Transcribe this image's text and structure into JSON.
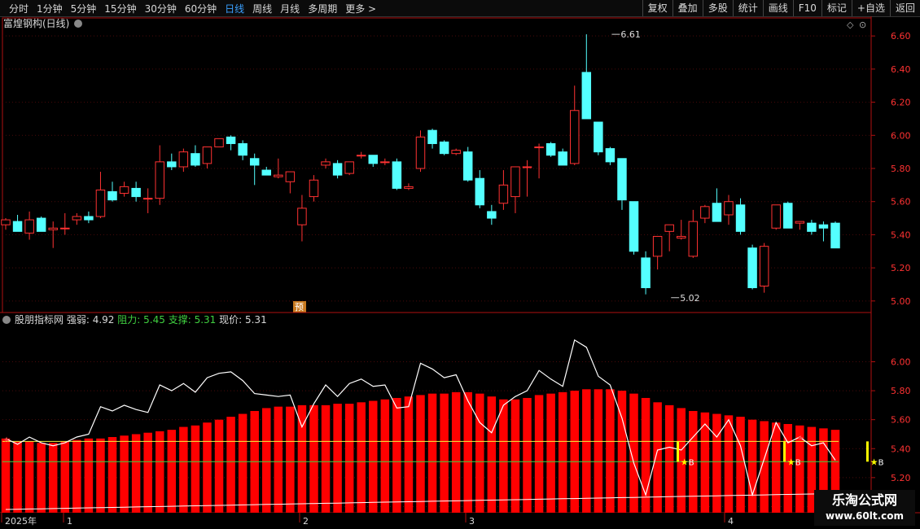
{
  "toolbar": {
    "periods": [
      "分时",
      "1分钟",
      "5分钟",
      "15分钟",
      "30分钟",
      "60分钟",
      "日线",
      "周线",
      "月线",
      "多周期",
      "更多 >"
    ],
    "active_period": "日线",
    "tools": [
      "复权",
      "叠加",
      "多股",
      "统计",
      "画线",
      "F10",
      "标记",
      "+自选",
      "返回"
    ]
  },
  "main_title": "富煌钢构(日线)",
  "pre_badge": "预",
  "indicator": {
    "name": "股朋指标网",
    "strength_label": "强弱:",
    "strength_value": "4.92",
    "resist_label": "阻力:",
    "resist_value": "5.45",
    "support_label": "支撑:",
    "support_value": "5.31",
    "price_label": "现价:",
    "price_value": "5.31"
  },
  "x_axis_labels": [
    "2025年",
    "1",
    "2",
    "3",
    "4"
  ],
  "watermark": {
    "line1": "乐淘公式网",
    "line2": "www.60lt.com"
  },
  "colors": {
    "up": "#ff3232",
    "down": "#54ffff",
    "bar_red": "#ff0000",
    "line_white": "#ffffff",
    "resist_line": "#f0f040",
    "support_line": "#40d040",
    "axis_red": "#b01010",
    "yellow": "#ffff00"
  },
  "chart_data": [
    {
      "type": "candlestick",
      "title": "富煌钢构(日线)",
      "ylim": [
        4.95,
        6.65
      ],
      "y_ticks": [
        5.0,
        5.2,
        5.4,
        5.6,
        5.8,
        6.0,
        6.2,
        6.4,
        6.6
      ],
      "annotations": [
        {
          "text": "6.61",
          "candle_index": 51,
          "value": 6.61
        },
        {
          "text": "5.02",
          "candle_index": 56,
          "value": 5.02
        }
      ],
      "ohlc": [
        [
          5.46,
          5.5,
          5.43,
          5.49
        ],
        [
          5.48,
          5.52,
          5.42,
          5.42
        ],
        [
          5.41,
          5.54,
          5.37,
          5.49
        ],
        [
          5.5,
          5.51,
          5.42,
          5.42
        ],
        [
          5.43,
          5.48,
          5.32,
          5.44
        ],
        [
          5.44,
          5.53,
          5.4,
          5.44
        ],
        [
          5.49,
          5.53,
          5.46,
          5.51
        ],
        [
          5.51,
          5.54,
          5.47,
          5.49
        ],
        [
          5.51,
          5.78,
          5.5,
          5.67
        ],
        [
          5.66,
          5.72,
          5.6,
          5.61
        ],
        [
          5.65,
          5.72,
          5.63,
          5.69
        ],
        [
          5.68,
          5.72,
          5.6,
          5.63
        ],
        [
          5.62,
          5.68,
          5.53,
          5.62
        ],
        [
          5.62,
          5.94,
          5.58,
          5.84
        ],
        [
          5.84,
          5.89,
          5.79,
          5.81
        ],
        [
          5.81,
          5.92,
          5.78,
          5.9
        ],
        [
          5.89,
          5.94,
          5.81,
          5.82
        ],
        [
          5.83,
          5.93,
          5.8,
          5.93
        ],
        [
          5.93,
          5.98,
          5.94,
          5.98
        ],
        [
          5.99,
          6.0,
          5.91,
          5.95
        ],
        [
          5.95,
          5.97,
          5.85,
          5.88
        ],
        [
          5.86,
          5.89,
          5.7,
          5.82
        ],
        [
          5.79,
          5.81,
          5.76,
          5.76
        ],
        [
          5.75,
          5.86,
          5.74,
          5.76
        ],
        [
          5.72,
          5.78,
          5.65,
          5.78
        ],
        [
          5.46,
          5.64,
          5.36,
          5.56
        ],
        [
          5.63,
          5.76,
          5.6,
          5.73
        ],
        [
          5.82,
          5.86,
          5.8,
          5.84
        ],
        [
          5.83,
          5.85,
          5.74,
          5.76
        ],
        [
          5.77,
          5.83,
          5.76,
          5.84
        ],
        [
          5.88,
          5.9,
          5.86,
          5.88
        ],
        [
          5.88,
          5.88,
          5.81,
          5.83
        ],
        [
          5.84,
          5.86,
          5.82,
          5.84
        ],
        [
          5.84,
          5.86,
          5.67,
          5.68
        ],
        [
          5.68,
          5.71,
          5.67,
          5.69
        ],
        [
          5.8,
          6.03,
          5.78,
          5.99
        ],
        [
          6.03,
          6.04,
          5.92,
          5.95
        ],
        [
          5.96,
          5.97,
          5.88,
          5.89
        ],
        [
          5.89,
          5.92,
          5.88,
          5.91
        ],
        [
          5.9,
          5.93,
          5.72,
          5.73
        ],
        [
          5.74,
          5.79,
          5.56,
          5.58
        ],
        [
          5.54,
          5.58,
          5.46,
          5.5
        ],
        [
          5.59,
          5.79,
          5.55,
          5.7
        ],
        [
          5.63,
          5.79,
          5.53,
          5.81
        ],
        [
          5.81,
          5.85,
          5.63,
          5.81
        ],
        [
          5.93,
          5.95,
          5.74,
          5.93
        ],
        [
          5.95,
          5.96,
          5.87,
          5.88
        ],
        [
          5.9,
          5.92,
          5.83,
          5.82
        ],
        [
          5.83,
          6.3,
          5.82,
          6.15
        ],
        [
          6.38,
          6.61,
          6.1,
          6.1
        ],
        [
          6.08,
          6.08,
          5.88,
          5.9
        ],
        [
          5.92,
          5.93,
          5.82,
          5.84
        ],
        [
          5.86,
          5.86,
          5.55,
          5.61
        ],
        [
          5.6,
          5.6,
          5.28,
          5.3
        ],
        [
          5.26,
          5.3,
          5.04,
          5.08
        ],
        [
          5.27,
          5.39,
          5.19,
          5.39
        ],
        [
          5.42,
          5.45,
          5.3,
          5.46
        ],
        [
          5.38,
          5.49,
          5.37,
          5.39
        ],
        [
          5.27,
          5.55,
          5.26,
          5.48
        ],
        [
          5.5,
          5.58,
          5.47,
          5.57
        ],
        [
          5.59,
          5.68,
          5.5,
          5.48
        ],
        [
          5.52,
          5.64,
          5.46,
          5.6
        ],
        [
          5.58,
          5.62,
          5.4,
          5.42
        ],
        [
          5.32,
          5.34,
          5.07,
          5.08
        ],
        [
          5.09,
          5.35,
          5.05,
          5.33
        ],
        [
          5.44,
          5.58,
          5.43,
          5.58
        ],
        [
          5.59,
          5.6,
          5.44,
          5.44
        ],
        [
          5.47,
          5.48,
          5.43,
          5.48
        ],
        [
          5.47,
          5.49,
          5.4,
          5.42
        ],
        [
          5.46,
          5.48,
          5.36,
          5.44
        ],
        [
          5.47,
          5.48,
          5.33,
          5.32
        ]
      ]
    },
    {
      "type": "bar+line",
      "title": "股朋指标网",
      "ylim": [
        4.98,
        6.25
      ],
      "y_ticks": [
        5.0,
        5.2,
        5.4,
        5.6,
        5.8,
        6.0
      ],
      "resistance": 5.45,
      "support": 5.31,
      "bar_values": [
        5.47,
        5.45,
        5.45,
        5.44,
        5.44,
        5.45,
        5.46,
        5.47,
        5.47,
        5.48,
        5.49,
        5.5,
        5.51,
        5.52,
        5.53,
        5.55,
        5.56,
        5.58,
        5.6,
        5.62,
        5.64,
        5.66,
        5.68,
        5.69,
        5.69,
        5.7,
        5.7,
        5.7,
        5.71,
        5.71,
        5.72,
        5.73,
        5.74,
        5.75,
        5.76,
        5.77,
        5.78,
        5.78,
        5.79,
        5.79,
        5.78,
        5.76,
        5.74,
        5.74,
        5.75,
        5.77,
        5.78,
        5.79,
        5.8,
        5.81,
        5.81,
        5.81,
        5.8,
        5.78,
        5.75,
        5.72,
        5.7,
        5.68,
        5.66,
        5.65,
        5.64,
        5.63,
        5.62,
        5.6,
        5.59,
        5.58,
        5.57,
        5.56,
        5.55,
        5.54,
        5.53
      ],
      "line_values": [
        5.47,
        5.43,
        5.48,
        5.44,
        5.42,
        5.44,
        5.48,
        5.5,
        5.69,
        5.66,
        5.7,
        5.67,
        5.65,
        5.84,
        5.8,
        5.85,
        5.79,
        5.89,
        5.92,
        5.93,
        5.87,
        5.78,
        5.77,
        5.76,
        5.77,
        5.55,
        5.71,
        5.84,
        5.76,
        5.85,
        5.88,
        5.83,
        5.84,
        5.68,
        5.69,
        5.99,
        5.95,
        5.89,
        5.91,
        5.73,
        5.58,
        5.51,
        5.7,
        5.76,
        5.8,
        5.94,
        5.88,
        5.83,
        6.15,
        6.1,
        5.9,
        5.84,
        5.61,
        5.3,
        5.08,
        5.39,
        5.41,
        5.39,
        5.48,
        5.57,
        5.48,
        5.6,
        5.42,
        5.08,
        5.33,
        5.58,
        5.44,
        5.48,
        5.42,
        5.44,
        5.32
      ],
      "buy_signals": [
        57,
        66,
        73
      ],
      "red_star_signals": [
        0,
        67
      ]
    }
  ]
}
